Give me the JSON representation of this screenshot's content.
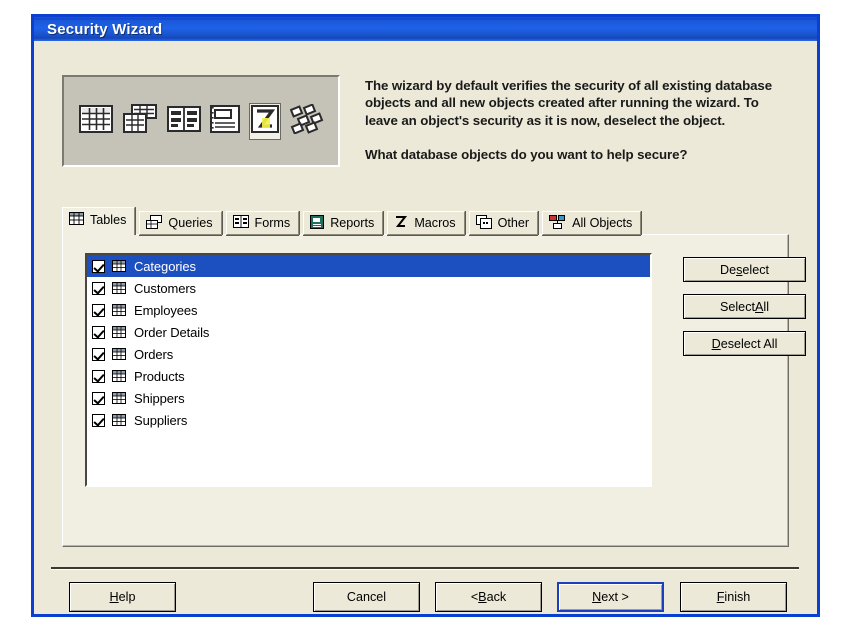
{
  "window": {
    "title": "Security Wizard"
  },
  "header": {
    "icons": [
      {
        "name": "table-object-icon",
        "selected": false
      },
      {
        "name": "query-object-icon",
        "selected": false
      },
      {
        "name": "form-object-icon",
        "selected": false
      },
      {
        "name": "report-object-icon",
        "selected": false
      },
      {
        "name": "macro-object-icon",
        "selected": true
      },
      {
        "name": "module-object-icon",
        "selected": false
      }
    ],
    "description": "The wizard by default verifies the security of all existing database objects and all new objects created after running the wizard. To leave an object's security as it is now, deselect the object.",
    "question": "What database objects do you want to help secure?"
  },
  "tabs": [
    {
      "label": "Tables",
      "icon": "table-icon",
      "active": true
    },
    {
      "label": "Queries",
      "icon": "query-icon",
      "active": false
    },
    {
      "label": "Forms",
      "icon": "form-icon",
      "active": false
    },
    {
      "label": "Reports",
      "icon": "report-icon",
      "active": false
    },
    {
      "label": "Macros",
      "icon": "macro-icon",
      "active": false
    },
    {
      "label": "Other",
      "icon": "other-icon",
      "active": false
    },
    {
      "label": "All Objects",
      "icon": "all-objects-icon",
      "active": false
    }
  ],
  "list": {
    "items": [
      {
        "label": "Categories",
        "checked": true,
        "selected": true
      },
      {
        "label": "Customers",
        "checked": true,
        "selected": false
      },
      {
        "label": "Employees",
        "checked": true,
        "selected": false
      },
      {
        "label": "Order Details",
        "checked": true,
        "selected": false
      },
      {
        "label": "Orders",
        "checked": true,
        "selected": false
      },
      {
        "label": "Products",
        "checked": true,
        "selected": false
      },
      {
        "label": "Shippers",
        "checked": true,
        "selected": false
      },
      {
        "label": "Suppliers",
        "checked": true,
        "selected": false
      }
    ]
  },
  "side_buttons": {
    "deselect": {
      "pre": "De",
      "accel": "s",
      "post": "elect"
    },
    "select_all": {
      "pre": "Select ",
      "accel": "A",
      "post": "ll"
    },
    "deselect_all": {
      "pre": "",
      "accel": "D",
      "post": "eselect All"
    }
  },
  "footer_buttons": {
    "help": {
      "pre": "",
      "accel": "H",
      "post": "elp"
    },
    "cancel": {
      "pre": "Cancel",
      "accel": "",
      "post": ""
    },
    "back": {
      "pre": "< ",
      "accel": "B",
      "post": "ack"
    },
    "next": {
      "pre": "",
      "accel": "N",
      "post": "ext >"
    },
    "finish": {
      "pre": "",
      "accel": "F",
      "post": "inish"
    }
  },
  "colors": {
    "titlebar_blue": "#1a56d8",
    "dialog_face": "#ece9d8",
    "selection_blue": "#1c4fbf",
    "panel_gray": "#c5c2b8"
  }
}
